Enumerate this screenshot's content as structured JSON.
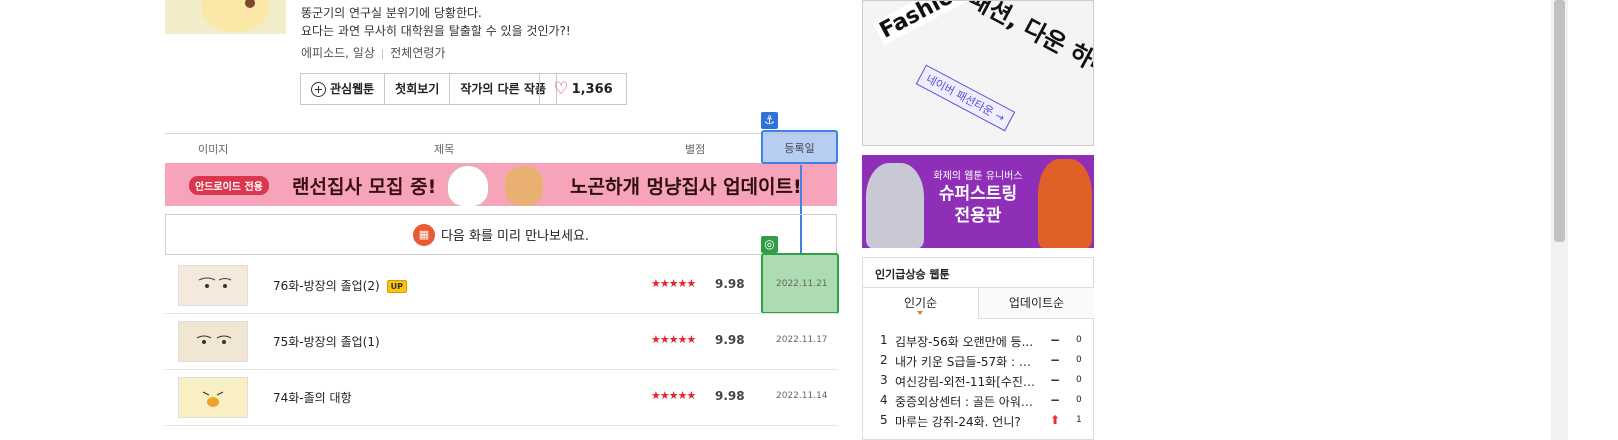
{
  "info": {
    "desc_line1": "똥군기의 연구실 분위기에 당황한다.",
    "desc_line2": "요다는 과연 무사히 대학원을 탈출할 수 있을 것인가?!",
    "genre": "에피소드, 일상",
    "age": "전체연령가",
    "buttons": {
      "favorite": "관심웹툰",
      "first": "첫회보기",
      "other": "작가의 다른 작품"
    },
    "likes": "1,366"
  },
  "table": {
    "headers": {
      "image": "이미지",
      "title": "제목",
      "rating": "별점",
      "date": "등록일"
    },
    "banner": {
      "tag": "안드로이드 전용",
      "text1": "랜선집사 모집 중!",
      "text2": "노곤하개 멍냥집사 업데이트!"
    },
    "preview": "다음 화를 미리 만나보세요.",
    "rows": [
      {
        "title": "76화-방장의 졸업(2)",
        "up": "UP",
        "stars": "★★★★★",
        "score": "9.98",
        "date": "2022.11.21"
      },
      {
        "title": "75화-방장의 졸업(1)",
        "up": "",
        "stars": "★★★★★",
        "score": "9.98",
        "date": "2022.11.17"
      },
      {
        "title": "74화-졸의 대항",
        "up": "",
        "stars": "★★★★★",
        "score": "9.98",
        "date": "2022.11.14"
      }
    ]
  },
  "annotation": {
    "anchor_icon": "anchor-icon",
    "target_icon": "target-icon",
    "colors": {
      "blue": "#3f82e4",
      "green": "#2fa043"
    }
  },
  "sidebar": {
    "ad1": {
      "brand": "FashionTown",
      "headline": "패션, 다운 하나로 끝.",
      "link": "네이버 패션타운 →"
    },
    "ad2": {
      "line1": "화제의 웹툰 유니버스",
      "line2": "슈퍼스트링",
      "line3": "전용관"
    },
    "ranking": {
      "title": "인기급상승 웹툰",
      "tabs": [
        "인기순",
        "업데이트순"
      ],
      "items": [
        {
          "num": "1",
          "title": "김부장-56화 오랜만에 등...",
          "change": "−",
          "count": "0"
        },
        {
          "num": "2",
          "title": "내가 키운 S급들-57화 : 한...",
          "change": "−",
          "count": "0"
        },
        {
          "num": "3",
          "title": "여신강림-외전-11화[수진ep]",
          "change": "−",
          "count": "0"
        },
        {
          "num": "4",
          "title": "중증외상센터 : 골든 아워-...",
          "change": "−",
          "count": "0"
        },
        {
          "num": "5",
          "title": "마루는 강쥐-24화. 언니?",
          "change": "⬆",
          "count": "1"
        }
      ]
    }
  }
}
